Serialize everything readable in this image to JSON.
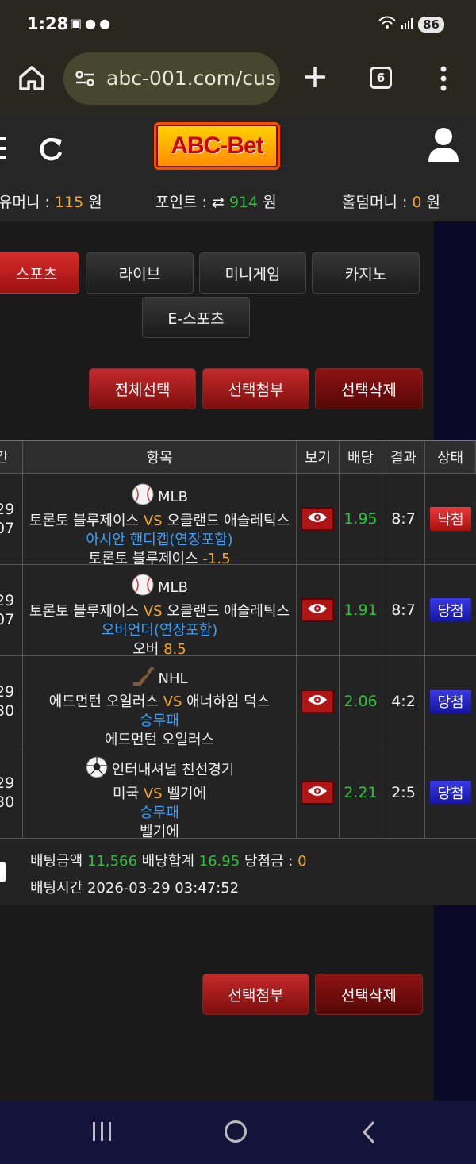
{
  "status_bar": {
    "time": "1:28",
    "battery": "86"
  },
  "browser": {
    "url": "abc-001.com/cus",
    "tab_count": "6"
  },
  "site": {
    "logo": "ABC-Bet",
    "money": {
      "label": "유머니 : ",
      "value": "115",
      "unit": " 원"
    },
    "points": {
      "label": "포인트 : ",
      "value": "914",
      "unit": " 원"
    },
    "holdem": {
      "label": "홀덤머니 : ",
      "value": "0",
      "unit": " 원"
    }
  },
  "nav": {
    "sports": "스포츠",
    "live": "라이브",
    "minigame": "미니게임",
    "casino": "카지노",
    "esports": "E-스포츠"
  },
  "actions_top": {
    "select_all": "전체선택",
    "attach_selected": "선택첨부",
    "delete_selected": "선택삭제"
  },
  "table": {
    "headers": {
      "time": "간",
      "item": "항목",
      "view": "보기",
      "odds": "배당",
      "result": "결과",
      "status": "상태"
    },
    "rows": [
      {
        "date1": "29",
        "date2": "07",
        "sport": "MLB",
        "home": "토론토 블루제이스",
        "vs": "VS",
        "away": "오클랜드 애슬레틱스",
        "market": "아시안 핸디캡(연장포함)",
        "pick": "토론토 블루제이스",
        "pick_value": "-1.5",
        "odds": "1.95",
        "result": "8:7",
        "status": "낙첨"
      },
      {
        "date1": "29",
        "date2": "07",
        "sport": "MLB",
        "home": "토론토 블루제이스",
        "vs": "VS",
        "away": "오클랜드 애슬레틱스",
        "market": "오버언더(연장포함)",
        "pick": "오버",
        "pick_value": "8.5",
        "odds": "1.91",
        "result": "8:7",
        "status": "당첨"
      },
      {
        "date1": "29",
        "date2": "30",
        "sport": "NHL",
        "home": "에드먼턴 오일러스",
        "vs": "VS",
        "away": "애너하임 덕스",
        "market": "승무패",
        "pick": "에드먼턴 오일러스",
        "pick_value": "",
        "odds": "2.06",
        "result": "4:2",
        "status": "당첨"
      },
      {
        "date1": "29",
        "date2": "30",
        "sport": "인터내셔널 친선경기",
        "home": "미국",
        "vs": "VS",
        "away": "벨기에",
        "market": "승무패",
        "pick": "벨기에",
        "pick_value": "",
        "odds": "2.21",
        "result": "2:5",
        "status": "당첨"
      }
    ],
    "summary": {
      "bet_amount_label": "배팅금액 ",
      "bet_amount": "11,566",
      "odds_total_label": " 배당합계 ",
      "odds_total": "16.95",
      "win_amount_label": " 당첨금 : ",
      "win_amount": "0",
      "bet_time_label": "배팅시간 ",
      "bet_time": "2026-03-29 03:47:52"
    }
  },
  "actions_bottom": {
    "attach_selected": "선택첨부",
    "delete_selected": "선택삭제"
  },
  "colors": {
    "accent_red": "#b01515",
    "win_blue": "#1414a0",
    "odds_green": "#2ec13e",
    "highlight_orange": "#f5a623",
    "link_blue": "#3aa0ff"
  }
}
